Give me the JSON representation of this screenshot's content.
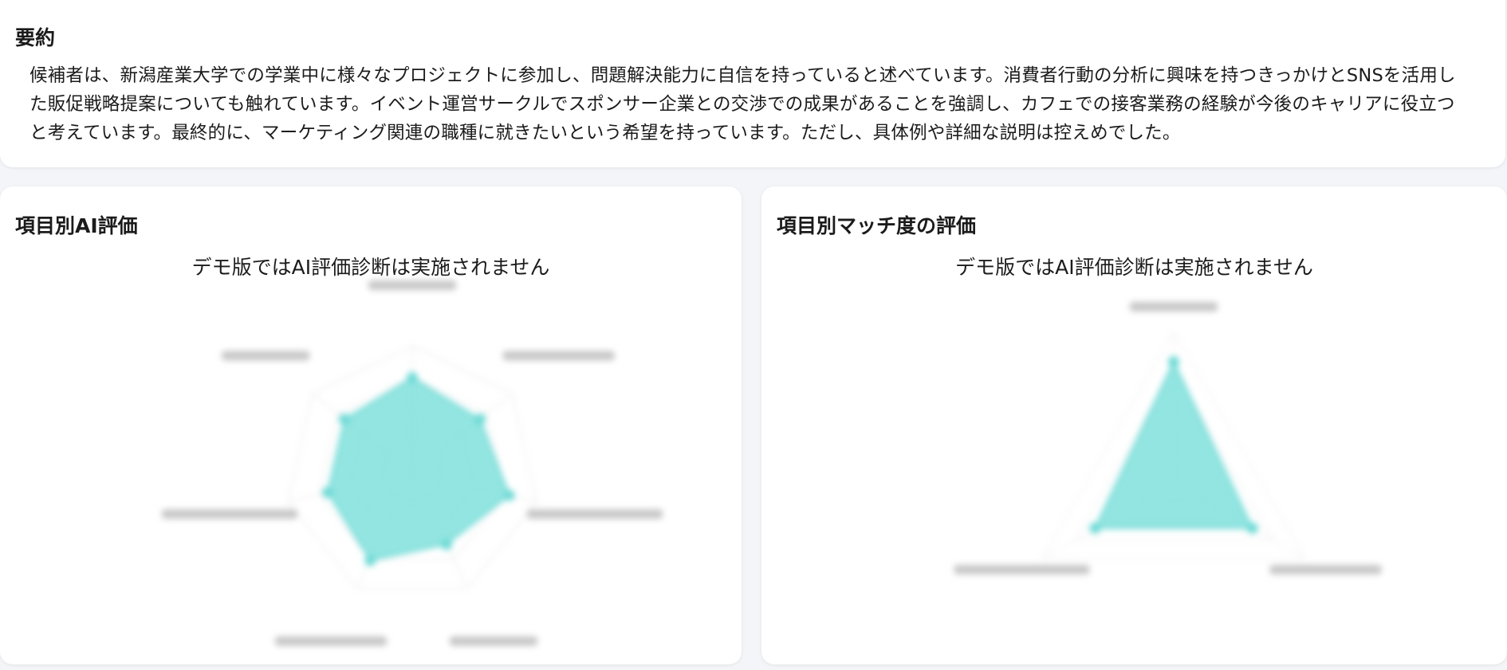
{
  "summary": {
    "title": "要約",
    "body": "候補者は、新潟産業大学での学業中に様々なプロジェクトに参加し、問題解決能力に自信を持っていると述べています。消費者行動の分析に興味を持つきっかけとSNSを活用した販促戦略提案についても触れています。イベント運営サークルでスポンサー企業との交渉での成果があることを強調し、カフェでの接客業務の経験が今後のキャリアに役立つと考えています。最終的に、マーケティング関連の職種に就きたいという希望を持っています。ただし、具体例や詳細な説明は控えめでした。"
  },
  "ai_panel": {
    "title": "項目別AI評価",
    "notice": "デモ版ではAI評価診断は実施されません"
  },
  "match_panel": {
    "title": "項目別マッチ度の評価",
    "notice": "デモ版ではAI評価診断は実施されません"
  },
  "colors": {
    "fill": "#7fe0dc",
    "background": "#f3f5f8",
    "card": "#ffffff"
  },
  "chart_data": [
    {
      "type": "radar",
      "axes": [
        "",
        "",
        "",
        "",
        "",
        "",
        ""
      ],
      "values": [
        0.75,
        0.68,
        0.78,
        0.62,
        0.76,
        0.68,
        0.68
      ],
      "max": 1,
      "grid": true
    },
    {
      "type": "radar",
      "axes": [
        "",
        "",
        ""
      ],
      "values": [
        0.8,
        0.6,
        0.6
      ],
      "max": 1,
      "grid": true
    }
  ]
}
